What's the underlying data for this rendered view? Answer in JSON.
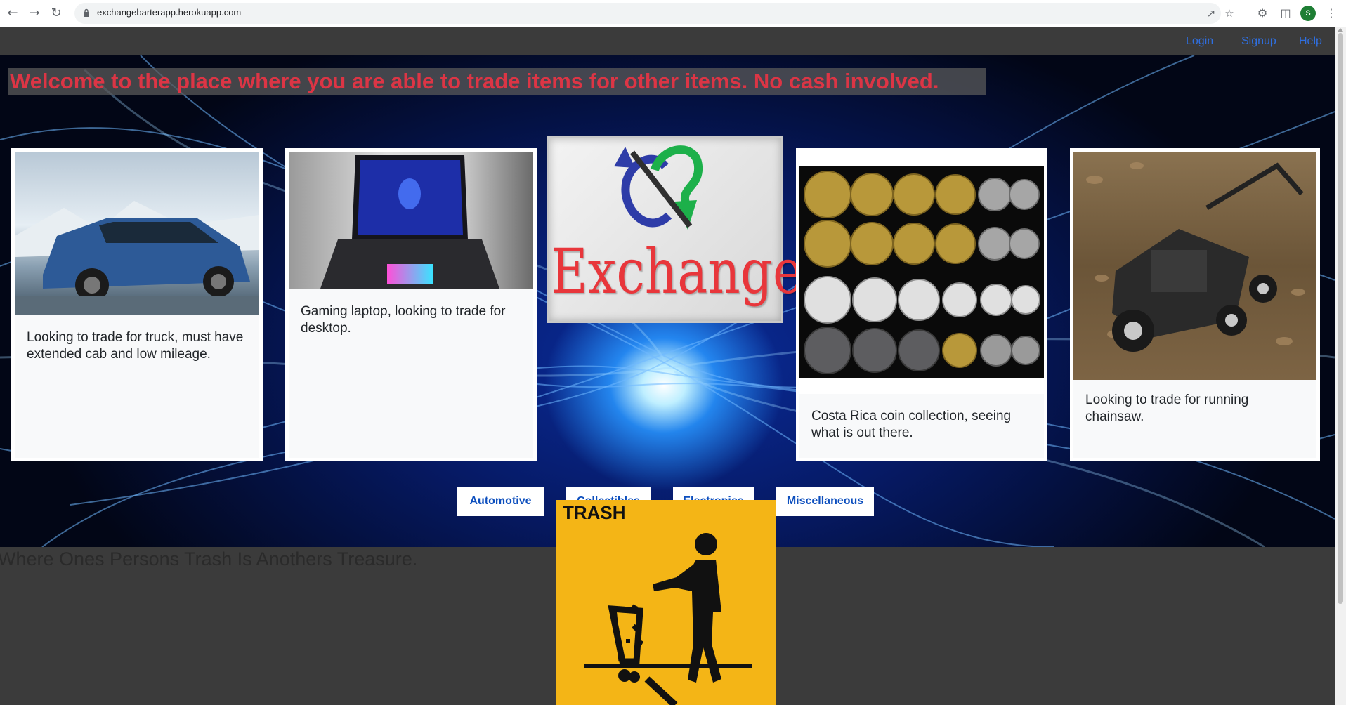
{
  "browser": {
    "url": "exchangebarterapp.herokuapp.com",
    "profile_initial": "S",
    "icons": [
      "back-icon",
      "forward-icon",
      "reload-icon",
      "lock-icon",
      "share-icon",
      "star-icon",
      "extensions-icon",
      "side-panel-icon",
      "menu-icon"
    ]
  },
  "nav": {
    "login": "Login",
    "signup": "Signup",
    "help": "Help",
    "link_color": "#2f6fe0"
  },
  "hero": {
    "welcome": "Welcome to the place where you are able to trade items for other items. No cash involved.",
    "welcome_color": "#dc3545"
  },
  "cards": [
    {
      "image": "blue SUV",
      "text": "Looking to trade for truck, must have extended cab and low mileage."
    },
    {
      "image": "gaming laptop",
      "text": "Gaming laptop, looking to trade for desktop."
    },
    {
      "image": "coin collection",
      "text": "Costa Rica coin collection, seeing what is out there."
    },
    {
      "image": "lawn mower",
      "text": "Looking to trade for running chainsaw."
    }
  ],
  "logo": {
    "text": "Exchange"
  },
  "categories": [
    "Automotive",
    "Collectibles",
    "Electronics",
    "Miscellaneous"
  ],
  "tagline": "Where Ones Persons Trash Is Anothers Treasure.",
  "trash_sign": {
    "label": "TRASH",
    "color": "#f4b516"
  }
}
